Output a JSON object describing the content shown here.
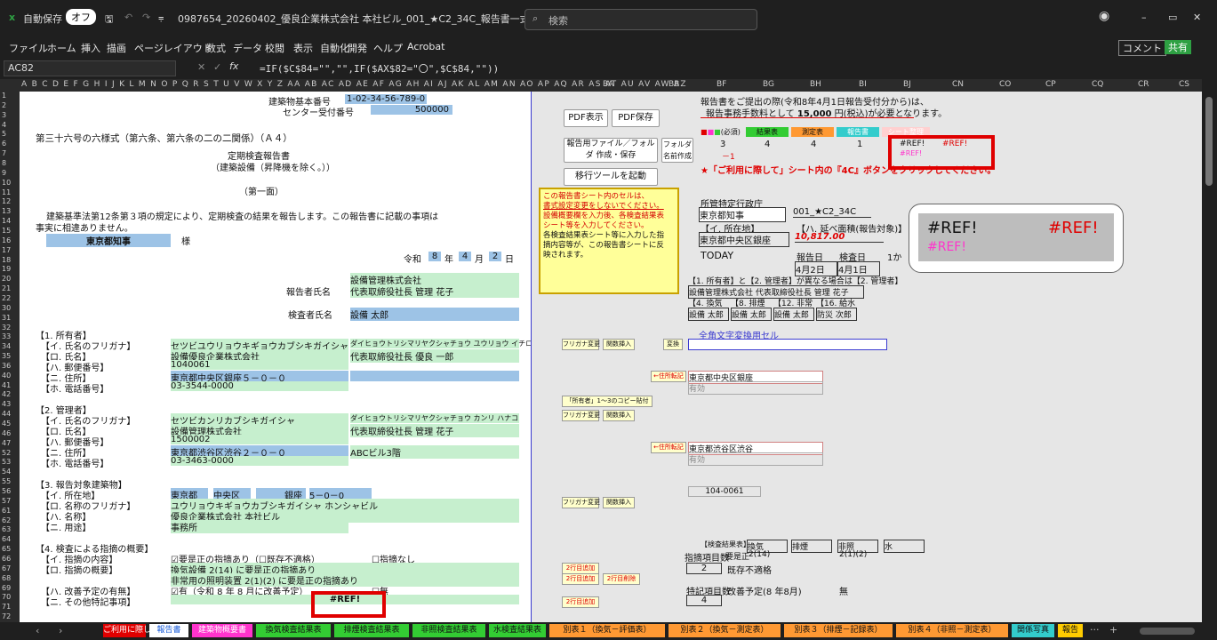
{
  "titlebar": {
    "autosave_label": "自動保存",
    "autosave_state": "オフ",
    "filename": "0987654_20260402_優良企業株式会社 本社ビル_001_★C2_34C_報告書一式_マクロ有 ・・・",
    "search_placeholder": "検索"
  },
  "ribbon": {
    "tabs": [
      "ファイル",
      "ホーム",
      "挿入",
      "描画",
      "ページレイアウト",
      "数式",
      "データ",
      "校閲",
      "表示",
      "自動化",
      "開発",
      "ヘルプ",
      "Acrobat"
    ],
    "comment_label": "コメント",
    "share_label": "共有"
  },
  "formulabar": {
    "namebox": "AC82",
    "fx": "fx",
    "formula": "=IF($C$84=\"\",\"\",IF($AX$82=\"〇\",$C$84,\"\"))"
  },
  "columns_left": "A B C D E F G H I J K L M N O P Q R S T U V W X Y Z AA AB AC AD AE AF AG AH AI AJ AK AL AM AN AO AP AQ AR AS AT AU AV AW AZ",
  "columns_right": [
    "BA",
    "BB",
    "BF",
    "BG",
    "BH",
    "BI",
    "BJ",
    "CN",
    "CO",
    "CP",
    "CQ",
    "CR",
    "CS"
  ],
  "rows": [
    "1",
    "2",
    "3",
    "4",
    "5",
    "6",
    "7",
    "8",
    "9",
    "10",
    "11",
    "12",
    "13",
    "14",
    "15",
    "16",
    "17",
    "18",
    "19",
    "20",
    "21",
    "22",
    "30",
    "31",
    "32",
    "33",
    "34",
    "35",
    "36",
    "40",
    "41",
    "42",
    "43",
    "44",
    "45",
    "46",
    "47",
    "52",
    "53",
    "54",
    "55",
    "56",
    "57",
    "61",
    "62",
    "63",
    "64",
    "65",
    "66",
    "67",
    "68",
    "69",
    "70",
    "71",
    "72"
  ],
  "form": {
    "bldg_no_label": "建築物基本番号",
    "bldg_no": [
      "1",
      "0",
      "2",
      "3",
      "4",
      "5",
      "6",
      "7",
      "8",
      "9",
      "0",
      "0"
    ],
    "center_label": "センター受付番号",
    "center_no": "500000",
    "form_title": "第三十六号の六様式（第六条、第六条の二の二関係）（Ａ４）",
    "report_title": "定期検査報告書",
    "report_sub": "（建築設備（昇降機を除く。））",
    "page_label": "（第一面）",
    "intro1": "建築基準法第12条第３項の規定により、定期検査の結果を報告します。この報告書に記載の事項は",
    "intro2": "事実に相違ありません。",
    "governor": "東京都知事",
    "sama": "様",
    "reiwa": "令和",
    "year": "8",
    "nen": "年",
    "month": "4",
    "tsuki": "月",
    "day": "2",
    "hi": "日",
    "reporter_label": "報告者氏名",
    "reporter_company": "設備管理株式会社",
    "reporter_name": "代表取締役社長 管理 花子",
    "inspector_label": "検査者氏名",
    "inspector_name": "設備 太郎",
    "owner_head": "【1. 所有者】",
    "owner_lines": [
      "【イ. 氏名のフリガナ】",
      "【ロ. 氏名】",
      "【ハ. 郵便番号】",
      "【ニ. 住所】",
      "【ホ. 電話番号】"
    ],
    "owner_kana1": "セツビユウリョウキギョウカブシキガイシャ",
    "owner_kana2": "ダイヒョウトリシマリヤクシャチョウ ユウリョウ イチロウ",
    "owner_name1": "設備優良企業株式会社",
    "owner_name2": "代表取締役社長 優良 一郎",
    "owner_zip": "1040061",
    "owner_addr": "東京都中央区銀座５－０－０",
    "owner_tel": "03-3544-0000",
    "mgr_head": "【2. 管理者】",
    "mgr_lines": [
      "【イ. 氏名のフリガナ】",
      "【ロ. 氏名】",
      "【ハ. 郵便番号】",
      "【ニ. 住所】",
      "【ホ. 電話番号】"
    ],
    "mgr_kana1": "セツビカンリカブシキガイシャ",
    "mgr_kana2": "ダイヒョウトリシマリヤクシャチョウ カンリ ハナコ",
    "mgr_name1": "設備管理株式会社",
    "mgr_name2": "代表取締役社長 管理 花子",
    "mgr_zip": "1500002",
    "mgr_addr": "東京都渋谷区渋谷２－０－０",
    "mgr_addr2": "ABCビル3階",
    "mgr_tel": "03-3463-0000",
    "bldg_head": "【3. 報告対象建築物】",
    "bldg_lines": [
      "【イ. 所在地】",
      "【ロ. 名称のフリガナ】",
      "【ハ. 名称】",
      "【ニ. 用途】"
    ],
    "bldg_pref": "東京都",
    "bldg_ward": "中央区",
    "bldg_town": "銀座",
    "bldg_num": "5－0－0",
    "bldg_kana": "ユウリョウキギョウカブシキガイシャ ホンシャビル",
    "bldg_name": "優良企業株式会社 本社ビル",
    "bldg_use": "事務所",
    "insp_head": "【4. 検査による指摘の概要】",
    "insp_lines": [
      "【イ. 指摘の内容】",
      "【ロ. 指摘の概要】",
      "",
      "【ハ. 改善予定の有無】",
      "【ニ. その他特記事項】"
    ],
    "insp_a": "要是正の指摘あり（",
    "insp_a2": "既存不適格）",
    "insp_a3": "指摘なし",
    "insp_b1": "換気設備 2(14) に要是正の指摘あり",
    "insp_b2": "非常用の照明装置 2(1)(2) に要是正の指摘あり",
    "insp_c": "有（令和 8 年 8 月に改善予定）",
    "insp_c2": "無",
    "insp_d": "#REF!"
  },
  "panel": {
    "pdf_show": "PDF表示",
    "pdf_save": "PDF保存",
    "create_folder": "報告用ファイル／フォルダ 作成・保存",
    "folder_name": "フォルダ 名前作成",
    "migrate": "移行ツールを起動",
    "warning": [
      "この報告書シート内のセルは、",
      "書式設定変更をしないでください。",
      "設備概要欄を入力後、各検査結果表",
      "シート等を入力してください。",
      "各検査結果表シート等に入力した指",
      "摘内容等が、この報告書シートに反",
      "映されます。"
    ],
    "notice1": "報告書をご提出の際(令和8年4月1日報告受付分から)は、",
    "notice2": "報告事務手数料として",
    "fee": "15,000",
    "notice3": "円(税込)が必要となります。",
    "legend": [
      "(必須)",
      "結果表",
      "測定表",
      "報告書",
      "シート整理"
    ],
    "counts": [
      "3",
      "4",
      "4",
      "1"
    ],
    "ref1": "#REF!",
    "ref2": "#REF!",
    "ref3": "#REF!",
    "minus1": "－1",
    "star_note": "★「ご利用に際して」シート内の『4C』ボタンをクリックしてください。",
    "authority_label": "所管特定行政庁",
    "authority": "東京都知事",
    "file_code": "001_★C2_34C",
    "addr_label": "【イ. 所在地】",
    "area_label": "【ハ. 延べ面積(報告対象)】",
    "addr": "東京都中央区銀座",
    "area": "10,817.00",
    "today_label": "TODAY",
    "report_date_label": "報告日",
    "insp_date_label": "検査日",
    "month_label": "1か",
    "report_date": "4月2日",
    "insp_date": "4月1日",
    "roles": "【1. 所有者】と【2. 管理者】が異なる場合は【2. 管理者】",
    "roles_val": "設備管理株式会社 代表取締役社長 管理 花子",
    "cats": [
      "【4. 換気",
      "【8. 排煙",
      "【12. 非常",
      "【16. 給水"
    ],
    "names": [
      "設備 太郎",
      "設備 太郎",
      "設備 太郎",
      "防災 次郎"
    ],
    "zenkaku": "全角文字変換用セル",
    "kana_btn": "フリガナ変更",
    "insert_btn": "関数挿入",
    "convert_btn": "変換",
    "addr_post_btn": "←住所転記",
    "owner_addr_val": "東京都中央区銀座",
    "valid": "有効",
    "copy_btn": "「所有者」1～3のコピー貼付",
    "mgr_addr_val": "東京都渋谷区渋谷",
    "zip_val": "104-0061",
    "insp_table_label": "【検査結果表】",
    "insp_cols": [
      "換気",
      "排煙",
      "非照",
      "水"
    ],
    "insp_vals": [
      "要是正",
      "2(14)",
      "",
      "2(1)(2)"
    ],
    "insp_count_label": "指摘項目数",
    "insp_count": "2",
    "existing": "既存不適格",
    "special_count_label": "特記項目数",
    "special_count": "4",
    "improve": "改善予定",
    "improve_val": "(8 年8月)",
    "nashi": "無",
    "add_row": "2行目追加",
    "del_row": "2行目削除",
    "zoom_ref_a": "#REF!",
    "zoom_ref_b": "#REF!",
    "zoom_ref_c": "#REF!"
  },
  "tabs": [
    {
      "label": "ご利用に際して",
      "color": "#e00000",
      "text": "#ffffff"
    },
    {
      "label": "報告書",
      "color": "#ffffff",
      "text": "#1a5cd8"
    },
    {
      "label": "建築物概要書",
      "color": "#ff33cc",
      "text": "#ffffff"
    },
    {
      "label": "換気検査結果表",
      "color": "#33cc33",
      "text": "#111111"
    },
    {
      "label": "排煙検査結果表",
      "color": "#33cc33",
      "text": "#111111"
    },
    {
      "label": "非照検査結果表",
      "color": "#33cc33",
      "text": "#111111"
    },
    {
      "label": "水検査結果表",
      "color": "#33cc33",
      "text": "#111111"
    },
    {
      "label": "別表１（換気－評価表）",
      "color": "#ff9933",
      "text": "#111111"
    },
    {
      "label": "別表２（換気－測定表）",
      "color": "#ff9933",
      "text": "#111111"
    },
    {
      "label": "別表３（排煙－記録表）",
      "color": "#ff9933",
      "text": "#111111"
    },
    {
      "label": "別表４（非照－測定表）",
      "color": "#ff9933",
      "text": "#111111"
    },
    {
      "label": "関係写真",
      "color": "#33cccc",
      "text": "#111111"
    },
    {
      "label": "報告",
      "color": "#ffcc00",
      "text": "#111111"
    }
  ],
  "colors": {
    "accent_red": "#e00000",
    "cell_blue": "#9dc3e6",
    "cell_green": "#c6efce",
    "warning_yellow": "#ffff99"
  }
}
